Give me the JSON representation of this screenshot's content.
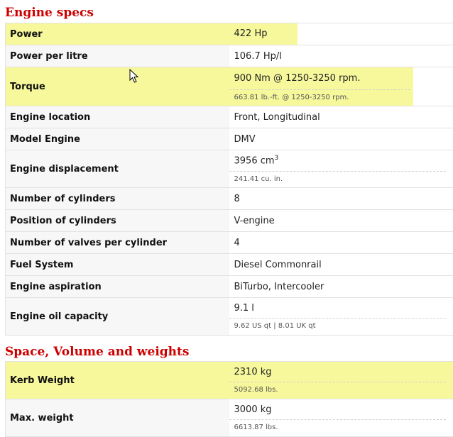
{
  "sections": [
    {
      "title": "Engine specs",
      "rows": [
        {
          "label": "Power",
          "value": "422 Hp"
        },
        {
          "label": "Power per litre",
          "value": "106.7 Hp/l"
        },
        {
          "label": "Torque",
          "value": "900 Nm @ 1250-3250 rpm.",
          "sub": "663.81 lb.-ft. @ 1250-3250 rpm."
        },
        {
          "label": "Engine location",
          "value": "Front, Longitudinal"
        },
        {
          "label": "Model Engine",
          "value": "DMV"
        },
        {
          "label": "Engine displacement",
          "value": "3956 cm",
          "value_sup": "3",
          "sub": "241.41 cu. in."
        },
        {
          "label": "Number of cylinders",
          "value": "8"
        },
        {
          "label": "Position of cylinders",
          "value": "V-engine"
        },
        {
          "label": "Number of valves per cylinder",
          "value": "4"
        },
        {
          "label": "Fuel System",
          "value": "Diesel Commonrail"
        },
        {
          "label": "Engine aspiration",
          "value": "BiTurbo, Intercooler"
        },
        {
          "label": "Engine oil capacity",
          "value": "9.1 l",
          "sub": "9.62 US qt | 8.01 UK qt"
        }
      ]
    },
    {
      "title": "Space, Volume and weights",
      "rows": [
        {
          "label": "Kerb Weight",
          "value": "2310 kg",
          "sub": "5092.68 lbs."
        },
        {
          "label": "Max. weight",
          "value": "3000 kg",
          "sub": "6613.87 lbs."
        }
      ]
    }
  ],
  "colors": {
    "heading": "#cc0000",
    "highlight": "#f7f89c"
  },
  "cursor_icon": "mouse-pointer-icon"
}
